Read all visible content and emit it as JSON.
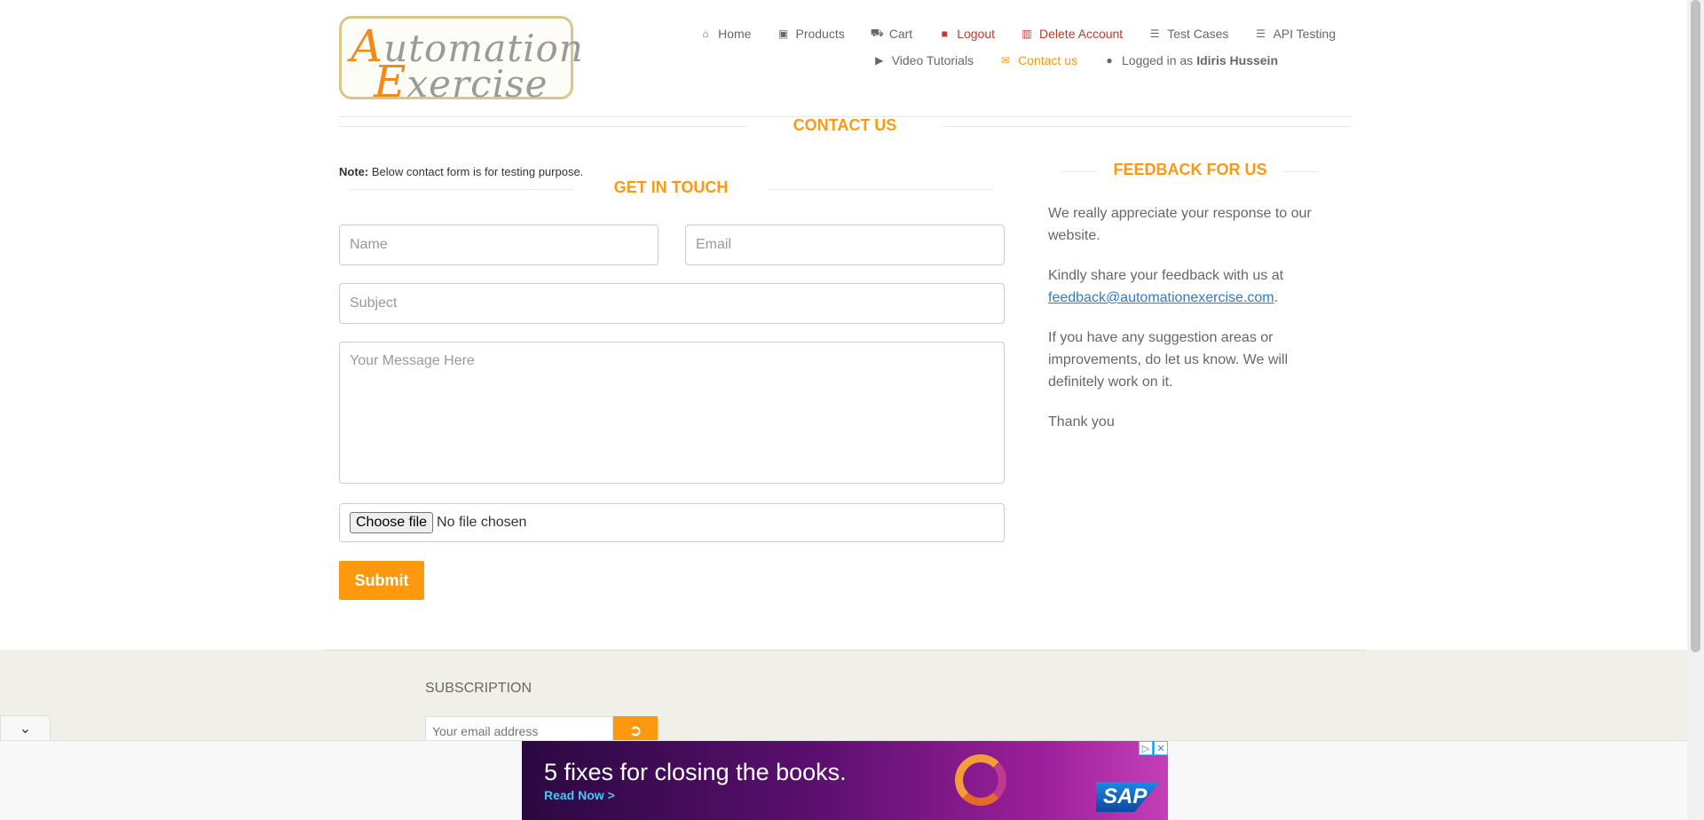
{
  "logo": {
    "line1": "Automation",
    "line2": "Exercise"
  },
  "nav": {
    "row1": [
      {
        "label": "Home",
        "icon": "home-icon",
        "glyph": "⌂"
      },
      {
        "label": "Products",
        "icon": "briefcase-icon",
        "glyph": "▣"
      },
      {
        "label": "Cart",
        "icon": "cart-icon",
        "glyph": "🛒"
      },
      {
        "label": "Logout",
        "icon": "lock-icon",
        "glyph": "🔒"
      },
      {
        "label": "Delete Account",
        "icon": "trash-icon",
        "glyph": "🗑"
      },
      {
        "label": "Test Cases",
        "icon": "list-icon",
        "glyph": "☰"
      },
      {
        "label": "API Testing",
        "icon": "list-icon",
        "glyph": "☰"
      }
    ],
    "row2": [
      {
        "label": "Video Tutorials",
        "icon": "video-icon",
        "glyph": "▶"
      },
      {
        "label": "Contact us",
        "icon": "envelope-icon",
        "glyph": "✉"
      },
      {
        "label": "Logged in as",
        "icon": "user-icon",
        "glyph": "👤",
        "user": "Idiris Hussein"
      }
    ]
  },
  "contact": {
    "title": "CONTACT US",
    "note_label": "Note:",
    "note_text": "Below contact form is for testing purpose.",
    "form_title": "GET IN TOUCH",
    "name_placeholder": "Name",
    "email_placeholder": "Email",
    "subject_placeholder": "Subject",
    "message_placeholder": "Your Message Here",
    "file_button": "Choose file",
    "file_status": "No file chosen",
    "submit_label": "Submit"
  },
  "feedback": {
    "title": "FEEDBACK FOR US",
    "p1": "We really appreciate your response to our website.",
    "p2_prefix": "Kindly share your feedback with us at",
    "p2_email": "feedback@automationexercise.com",
    "p2_suffix": ".",
    "p3": "If you have any suggestion areas or improvements, do let us know. We will definitely work on it.",
    "p4": "Thank you"
  },
  "footer": {
    "subscription_title": "SUBSCRIPTION",
    "email_placeholder": "Your email address"
  },
  "ad": {
    "headline": "5 fixes for closing the books.",
    "cta": "Read Now >",
    "brand": "SAP"
  },
  "colors": {
    "accent": "#fe980f",
    "danger": "#c0392b",
    "link": "#2e7bcf",
    "footer_bg": "#f0f0e9"
  }
}
